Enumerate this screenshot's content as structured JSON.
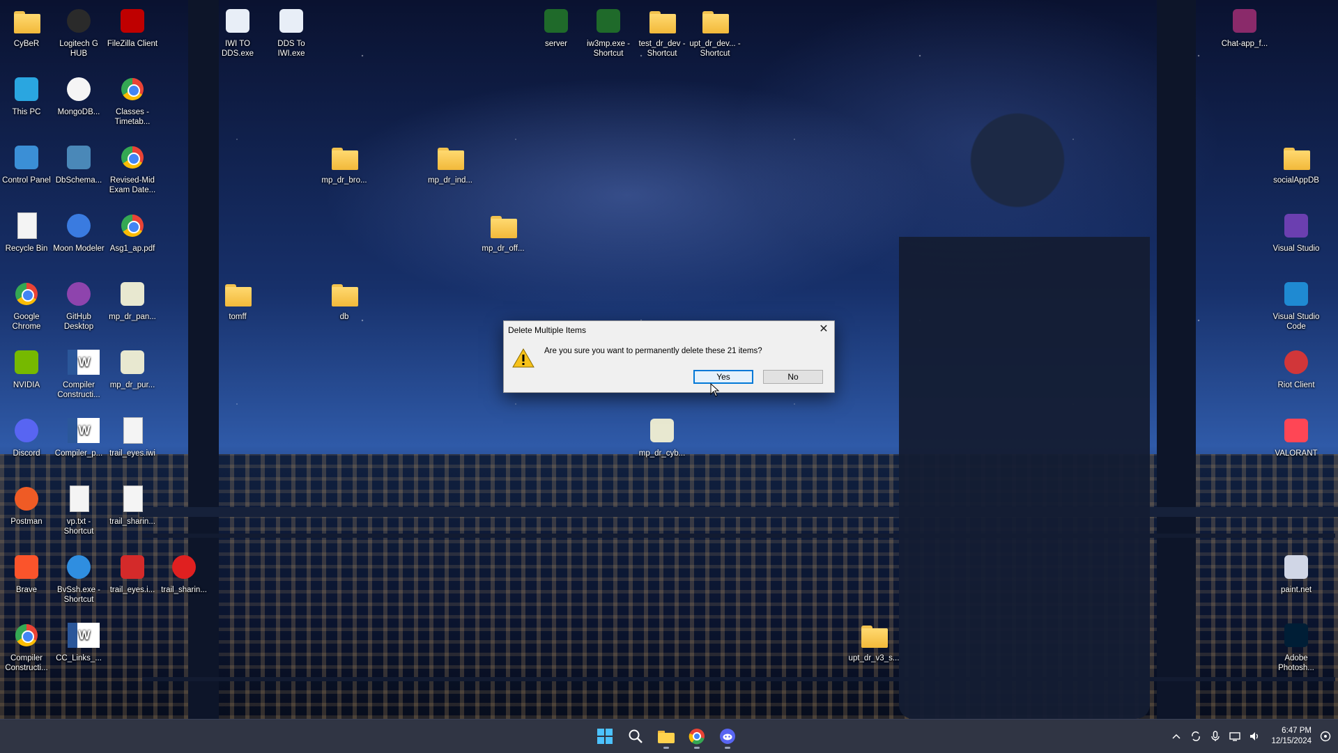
{
  "desktop": {
    "icons": [
      {
        "label": "CyBeR",
        "kind": "folder"
      },
      {
        "label": "This PC",
        "kind": "square",
        "color": "#2aa6e0"
      },
      {
        "label": "Control Panel",
        "kind": "square",
        "color": "#3b8fd6"
      },
      {
        "label": "Recycle Bin",
        "kind": "doc"
      },
      {
        "label": "Google Chrome",
        "kind": "chrome"
      },
      {
        "label": "NVIDIA",
        "kind": "square",
        "color": "#76b900"
      },
      {
        "label": "Discord",
        "kind": "round",
        "color": "#5865f2"
      },
      {
        "label": "Postman",
        "kind": "round",
        "color": "#ef5b25"
      },
      {
        "label": "Brave",
        "kind": "square",
        "color": "#fb542b"
      },
      {
        "label": "Compiler Constructi...",
        "kind": "chrome"
      },
      {
        "label": "Logitech G HUB",
        "kind": "round",
        "color": "#2a2a2a"
      },
      {
        "label": "MongoDB...",
        "kind": "round",
        "color": "#f5f5f5"
      },
      {
        "label": "DbSchema...",
        "kind": "square",
        "color": "#4a88b8"
      },
      {
        "label": "Moon Modeler",
        "kind": "round",
        "color": "#3a7be0"
      },
      {
        "label": "GitHub Desktop",
        "kind": "round",
        "color": "#8e44ad"
      },
      {
        "label": "Compiler Constructi...",
        "kind": "word"
      },
      {
        "label": "Compiler_p...",
        "kind": "word"
      },
      {
        "label": "vp.txt - Shortcut",
        "kind": "doc"
      },
      {
        "label": "BvSsh.exe - Shortcut",
        "kind": "round",
        "color": "#2f8ee0"
      },
      {
        "label": "CC_Links_...",
        "kind": "word"
      },
      {
        "label": "FileZilla Client",
        "kind": "square",
        "color": "#bf0000"
      },
      {
        "label": "Classes - Timetab...",
        "kind": "chrome"
      },
      {
        "label": "Revised-Mid Exam Date...",
        "kind": "chrome"
      },
      {
        "label": "Asg1_ap.pdf",
        "kind": "chrome"
      },
      {
        "label": "mp_dr_pan...",
        "kind": "square",
        "color": "#e8e8d0"
      },
      {
        "label": "mp_dr_pur...",
        "kind": "square",
        "color": "#e8e8d0"
      },
      {
        "label": "trail_eyes.iwi",
        "kind": "doc"
      },
      {
        "label": "trail_sharin...",
        "kind": "doc"
      },
      {
        "label": "trail_eyes.i...",
        "kind": "square",
        "color": "#d42a2a"
      },
      {
        "label": "trail_sharin...",
        "kind": "round",
        "color": "#e02020"
      },
      {
        "label": "IWI TO DDS.exe",
        "kind": "square",
        "color": "#e8eef7"
      },
      {
        "label": "DDS To IWI.exe",
        "kind": "square",
        "color": "#e8eef7"
      },
      {
        "label": "mp_dr_bro...",
        "kind": "folder"
      },
      {
        "label": "mp_dr_ind...",
        "kind": "folder"
      },
      {
        "label": "mp_dr_off...",
        "kind": "folder"
      },
      {
        "label": "tomff",
        "kind": "folder"
      },
      {
        "label": "db",
        "kind": "folder"
      },
      {
        "label": "server",
        "kind": "square",
        "color": "#1f6a2a"
      },
      {
        "label": "iw3mp.exe - Shortcut",
        "kind": "square",
        "color": "#1f6a2a"
      },
      {
        "label": "test_dr_dev - Shortcut",
        "kind": "folder"
      },
      {
        "label": "upt_dr_dev... - Shortcut",
        "kind": "folder"
      },
      {
        "label": "mp_dr_cyb...",
        "kind": "square",
        "color": "#e8e8d0"
      },
      {
        "label": "upt_dr_v3_s...",
        "kind": "folder"
      },
      {
        "label": "Chat-app_f...",
        "kind": "square",
        "color": "#8a2a6a"
      },
      {
        "label": "socialAppDB",
        "kind": "folder"
      },
      {
        "label": "Visual Studio",
        "kind": "square",
        "color": "#6b3fb0"
      },
      {
        "label": "Visual Studio Code",
        "kind": "square",
        "color": "#1f8ad2"
      },
      {
        "label": "Riot Client",
        "kind": "round",
        "color": "#d13639"
      },
      {
        "label": "VALORANT",
        "kind": "square",
        "color": "#ff4655"
      },
      {
        "label": "paint.net",
        "kind": "square",
        "color": "#d0d6e6"
      },
      {
        "label": "Adobe Photosh...",
        "kind": "square",
        "color": "#001e36"
      }
    ]
  },
  "dialog": {
    "title": "Delete Multiple Items",
    "message": "Are you sure you want to permanently delete these 21 items?",
    "yes_label": "Yes",
    "no_label": "No",
    "close_glyph": "✕"
  },
  "taskbar": {
    "apps": [
      "start-icon",
      "search-icon",
      "file-explorer-icon",
      "chrome-icon",
      "discord-icon"
    ],
    "time": "6:47 PM",
    "date": "12/15/2024"
  }
}
